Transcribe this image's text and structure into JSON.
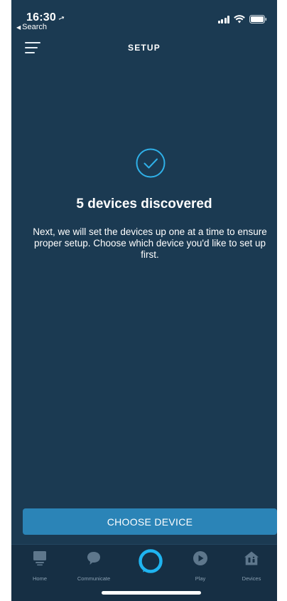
{
  "status_bar": {
    "time": "16:30",
    "location_arrow": "➚",
    "back_label": "Search"
  },
  "header": {
    "title": "SETUP",
    "menu_icon": "hamburger-menu-icon"
  },
  "content": {
    "status_icon": "check-circle-icon",
    "headline": "5 devices discovered",
    "description": "Next, we will set the devices up one at a time to ensure proper setup. Choose which device you'd like to set up first."
  },
  "primary_button": {
    "label": "CHOOSE DEVICE"
  },
  "tab_bar": {
    "tabs": [
      {
        "label": "Home",
        "icon": "home-icon"
      },
      {
        "label": "Communicate",
        "icon": "chat-bubble-icon"
      },
      {
        "label": "",
        "icon": "alexa-ring-icon"
      },
      {
        "label": "Play",
        "icon": "play-icon"
      },
      {
        "label": "Devices",
        "icon": "devices-house-icon"
      }
    ]
  },
  "colors": {
    "background": "#1b3a52",
    "tab_bar_background": "#162f44",
    "accent": "#2b84b7",
    "check_color": "#2fb0e8",
    "alexa_ring": "#1fb4f0",
    "tab_label": "#8aa0b2"
  }
}
